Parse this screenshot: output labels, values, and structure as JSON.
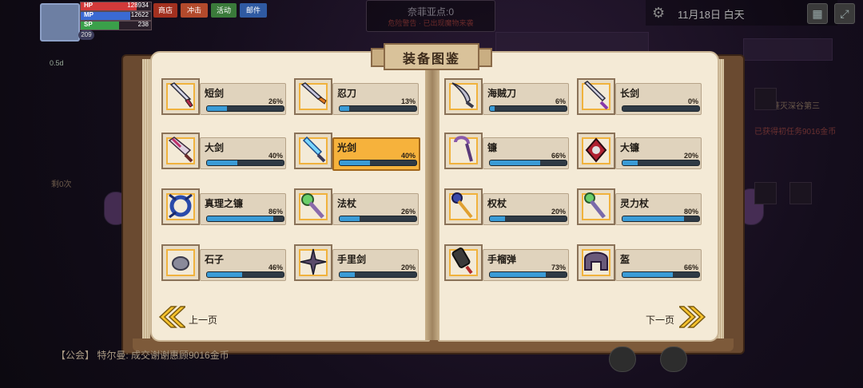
{
  "hud": {
    "hp_label": "HP",
    "hp_value": "128934",
    "hp_pct": 0.8,
    "mp_label": "MP",
    "mp_value": "12622",
    "mp_pct": 0.7,
    "sp_label": "SP",
    "sp_value": "238",
    "sp_pct": 0.55,
    "level": "209",
    "buttons": [
      "商店",
      "冲击",
      "活动",
      "邮件"
    ],
    "mini_text": "0.5d"
  },
  "top_center": {
    "line1": "奈菲亚点:0",
    "line2": "危险警告 · 已出现魔物来袭"
  },
  "top_right": {
    "date": "11月18日  白天"
  },
  "side": {
    "left_text": "剩0次",
    "right_text1": "蓬灭深谷第三",
    "right_text2": "已获得初任务9016金币"
  },
  "book": {
    "title": "装备图鉴",
    "prev_label": "上一页",
    "next_label": "下一页",
    "left_items": [
      {
        "name": "短剑",
        "percent": "26%",
        "fill": 0.26,
        "icon": "short-sword-icon",
        "selected": false
      },
      {
        "name": "忍刀",
        "percent": "13%",
        "fill": 0.13,
        "icon": "ninja-blade-icon",
        "selected": false
      },
      {
        "name": "大剑",
        "percent": "40%",
        "fill": 0.4,
        "icon": "great-sword-icon",
        "selected": false
      },
      {
        "name": "光剑",
        "percent": "40%",
        "fill": 0.4,
        "icon": "light-sword-icon",
        "selected": true
      },
      {
        "name": "真理之镰",
        "percent": "86%",
        "fill": 0.86,
        "icon": "truth-scythe-icon",
        "selected": false
      },
      {
        "name": "法杖",
        "percent": "26%",
        "fill": 0.26,
        "icon": "magic-staff-icon",
        "selected": false
      },
      {
        "name": "石子",
        "percent": "46%",
        "fill": 0.46,
        "icon": "pebble-icon",
        "selected": false
      },
      {
        "name": "手里剑",
        "percent": "20%",
        "fill": 0.2,
        "icon": "shuriken-icon",
        "selected": false
      }
    ],
    "right_items": [
      {
        "name": "海贼刀",
        "percent": "6%",
        "fill": 0.06,
        "icon": "pirate-blade-icon",
        "selected": false
      },
      {
        "name": "长剑",
        "percent": "0%",
        "fill": 0.0,
        "icon": "long-sword-icon",
        "selected": false
      },
      {
        "name": "镰",
        "percent": "66%",
        "fill": 0.66,
        "icon": "sickle-icon",
        "selected": false
      },
      {
        "name": "大镰",
        "percent": "20%",
        "fill": 0.2,
        "icon": "great-scythe-icon",
        "selected": false
      },
      {
        "name": "权杖",
        "percent": "20%",
        "fill": 0.2,
        "icon": "scepter-icon",
        "selected": false
      },
      {
        "name": "灵力杖",
        "percent": "80%",
        "fill": 0.8,
        "icon": "spirit-staff-icon",
        "selected": false
      },
      {
        "name": "手榴弹",
        "percent": "73%",
        "fill": 0.73,
        "icon": "grenade-icon",
        "selected": false
      },
      {
        "name": "盔",
        "percent": "66%",
        "fill": 0.66,
        "icon": "helmet-icon",
        "selected": false
      }
    ]
  },
  "chat": {
    "text": "【公会】 特尔曼: 成交谢谢惠顾9016金币"
  },
  "colors": {
    "accent": "#f6b23c",
    "bar_fill": "#3a9bd6",
    "page": "#f4ead6"
  }
}
